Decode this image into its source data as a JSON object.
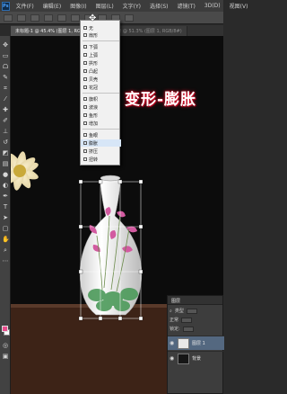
{
  "menubar": {
    "logo": "Ps",
    "items": [
      "文件(F)",
      "编辑(E)",
      "图像(I)",
      "图层(L)",
      "文字(Y)",
      "选择(S)",
      "滤镜(T)",
      "3D(D)",
      "视图(V)"
    ]
  },
  "tabs": [
    {
      "label": "未标题-1 @ 45.4% (图层 1, RGB/8#)"
    },
    {
      "label": "未标题-2 @ 51.3% (图层 1, RGB/8#)"
    }
  ],
  "canvas_text": "变形-膨胀",
  "dropdown": {
    "items": [
      "无",
      "扇形",
      "下弧",
      "上弧",
      "拱形",
      "凸起",
      "贝壳",
      "花冠",
      "旗帜",
      "波浪",
      "鱼形",
      "增加",
      "鱼眼",
      "膨胀",
      "挤压",
      "扭转"
    ],
    "hover_index": 13
  },
  "layers_panel": {
    "tab": "图层",
    "kind_label": "类型",
    "blend_mode": "正常",
    "lock_label": "锁定:",
    "layers": [
      {
        "name": "图层 1",
        "selected": true
      },
      {
        "name": "背景",
        "selected": false
      }
    ]
  },
  "colors": {
    "foreground": "#e84c8c",
    "background": "#ffffff",
    "title_glow": "#d0102a"
  }
}
